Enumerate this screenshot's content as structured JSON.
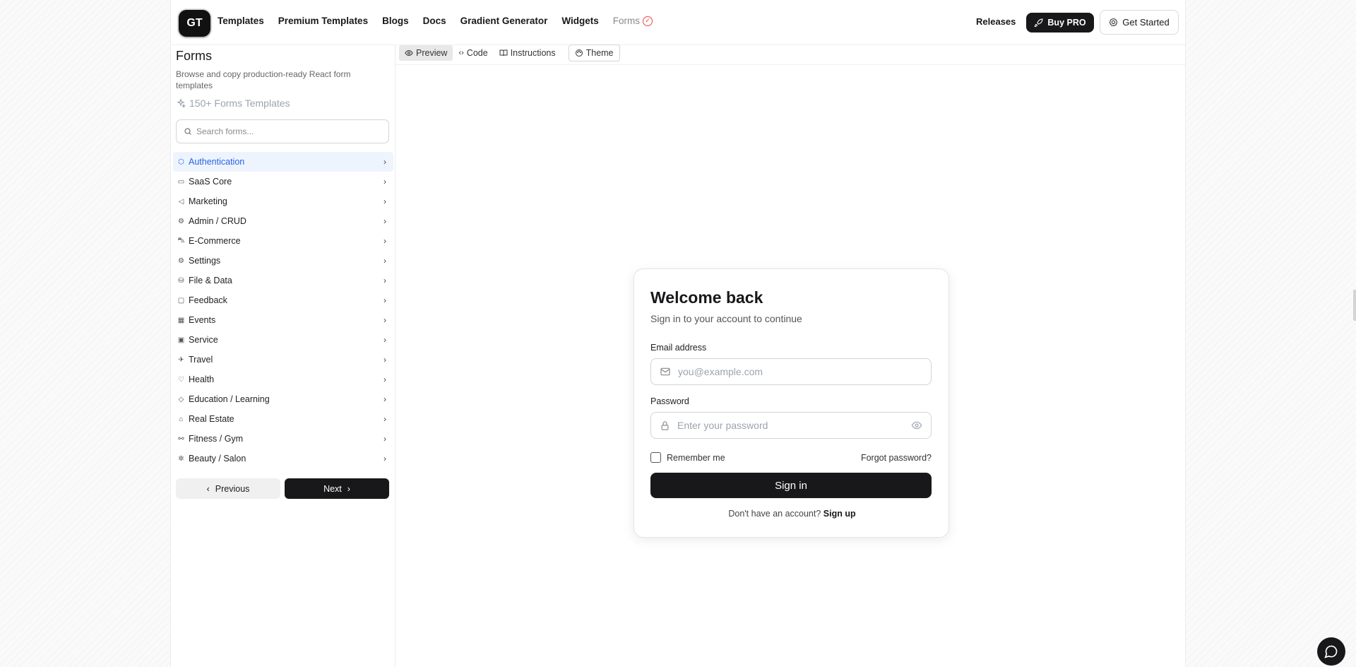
{
  "header": {
    "logo_text": "GT",
    "nav": [
      "Templates",
      "Premium Templates",
      "Blogs",
      "Docs",
      "Gradient Generator",
      "Widgets"
    ],
    "nav_forms": "Forms",
    "releases": "Releases",
    "buy_pro": "Buy PRO",
    "get_started": "Get Started"
  },
  "sidebar": {
    "title": "Forms",
    "description": "Browse and copy production-ready React form templates",
    "count": "150+ Forms Templates",
    "search_placeholder": "Search forms...",
    "categories": [
      {
        "label": "Authentication",
        "icon": "shield-icon",
        "active": true
      },
      {
        "label": "SaaS Core",
        "icon": "credit-card-icon"
      },
      {
        "label": "Marketing",
        "icon": "megaphone-icon"
      },
      {
        "label": "Admin / CRUD",
        "icon": "gear-icon"
      },
      {
        "label": "E-Commerce",
        "icon": "cart-icon"
      },
      {
        "label": "Settings",
        "icon": "settings-icon"
      },
      {
        "label": "File & Data",
        "icon": "database-icon"
      },
      {
        "label": "Feedback",
        "icon": "message-icon"
      },
      {
        "label": "Events",
        "icon": "calendar-icon"
      },
      {
        "label": "Service",
        "icon": "briefcase-icon"
      },
      {
        "label": "Travel",
        "icon": "plane-icon"
      },
      {
        "label": "Health",
        "icon": "heart-icon"
      },
      {
        "label": "Education / Learning",
        "icon": "graduation-cap-icon"
      },
      {
        "label": "Real Estate",
        "icon": "home-icon"
      },
      {
        "label": "Fitness / Gym",
        "icon": "dumbbell-icon"
      },
      {
        "label": "Beauty / Salon",
        "icon": "sparkle-icon"
      }
    ],
    "prev": "Previous",
    "next": "Next"
  },
  "tabs": {
    "preview": "Preview",
    "code": "Code",
    "instructions": "Instructions",
    "theme": "Theme"
  },
  "login": {
    "title": "Welcome back",
    "subtitle": "Sign in to your account to continue",
    "email_label": "Email address",
    "email_placeholder": "you@example.com",
    "password_label": "Password",
    "password_placeholder": "Enter your password",
    "remember": "Remember me",
    "forgot": "Forgot password?",
    "sign_in": "Sign in",
    "no_account": "Don't have an account?",
    "sign_up": "Sign up"
  },
  "colors": {
    "accent": "#2563eb",
    "dark": "#18181b",
    "active_bg": "#eef4fd"
  }
}
